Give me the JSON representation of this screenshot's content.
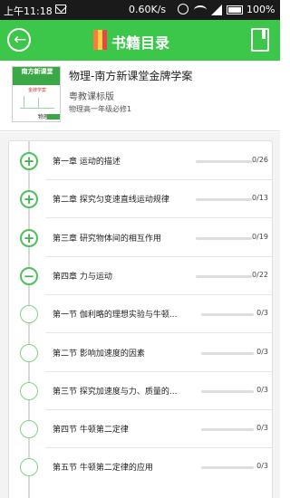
{
  "status_bar": {
    "time": "上午11:18",
    "speed": "0.60K/s",
    "battery": "100%",
    "icons": [
      "mail-icon",
      "alarm-icon",
      "wifi-icon",
      "signal-icon",
      "battery-icon"
    ]
  },
  "app_bar": {
    "title": "书籍目录",
    "accent": "#3cc64a",
    "icons": [
      "back-arrow-icon",
      "books-icon",
      "bookmark-icon"
    ]
  },
  "book": {
    "title": "物理-南方新课堂金牌学案",
    "edition": "粤教课标版",
    "grade": "物理高一年级必修1",
    "cover_text": {
      "brand": "南方新课堂",
      "brand_sub": "金牌学案",
      "subject": "物理"
    }
  },
  "toc": [
    {
      "type": "chapter",
      "expanded": false,
      "label": "第一章  运动的描述",
      "progress": 0,
      "count": "0/26"
    },
    {
      "type": "chapter",
      "expanded": false,
      "label": "第二章  探究匀变速直线运动规律",
      "progress": 0,
      "count": "0/13"
    },
    {
      "type": "chapter",
      "expanded": false,
      "label": "第三章  研究物体间的相互作用",
      "progress": 0,
      "count": "0/19"
    },
    {
      "type": "chapter",
      "expanded": true,
      "label": "第四章  力与运动",
      "progress": 0,
      "count": "0/22"
    },
    {
      "type": "section",
      "label": "第一节  伽利略的理想实验与牛顿...",
      "progress": 0,
      "count": "0/3"
    },
    {
      "type": "section",
      "label": "第二节  影响加速度的因素",
      "progress": 0,
      "count": "0/3"
    },
    {
      "type": "section",
      "label": "第三节  探究加速度与力、质量的...",
      "progress": 0,
      "count": "0/3"
    },
    {
      "type": "section",
      "label": "第四节  牛顿第二定律",
      "progress": 0,
      "count": "0/3"
    },
    {
      "type": "section",
      "label": "第五节  牛顿第二定律的应用",
      "progress": 0,
      "count": "0/3"
    }
  ],
  "symbols": {
    "collapsed": "+",
    "expanded": "−"
  }
}
